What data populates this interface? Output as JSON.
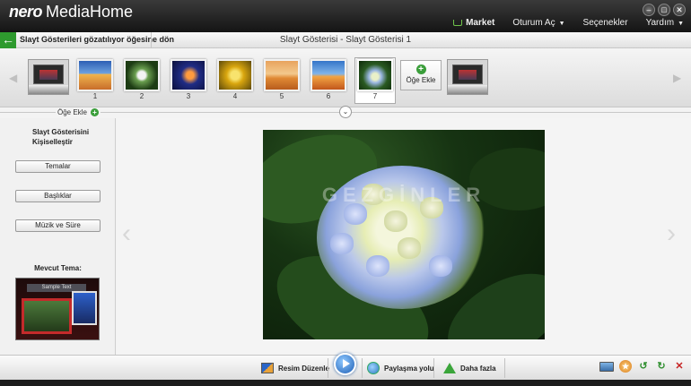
{
  "app": {
    "brand_nero": "nero",
    "brand_product": "MediaHome"
  },
  "window_controls": {
    "minimize": "–",
    "restore": "□",
    "close": "✕"
  },
  "topmenu": {
    "market": "Market",
    "login": "Oturum Aç",
    "options": "Seçenekler",
    "help": "Yardım"
  },
  "navbar": {
    "back_label": "Slayt Gösterileri gözatılıyor öğesine dön",
    "title": "Slayt Gösterisi - Slayt Gösterisi 1"
  },
  "strip": {
    "thumbnails": [
      {
        "number": "1",
        "scene": "desert-dune"
      },
      {
        "number": "2",
        "scene": "white-flower"
      },
      {
        "number": "3",
        "scene": "jellyfish"
      },
      {
        "number": "4",
        "scene": "yellow-flowers"
      },
      {
        "number": "5",
        "scene": "desert-camel"
      },
      {
        "number": "6",
        "scene": "desert-camel-sunset"
      },
      {
        "number": "7",
        "scene": "hydrangea"
      }
    ],
    "selected": "7",
    "add_item_label": "Öğe Ekle"
  },
  "stripfoot": {
    "add_item_label": "Öğe Ekle"
  },
  "leftpanel": {
    "title": "Slayt Gösterisini Kişiselleştir",
    "buttons": {
      "themes": "Temalar",
      "titles": "Başlıklar",
      "music": "Müzik ve Süre"
    },
    "current_theme_label": "Mevcut Tema:",
    "theme_preview_text": "Sample Text"
  },
  "preview": {
    "watermark": "GEZGİNLER"
  },
  "bottombar": {
    "edit_image": "Resim Düzenle",
    "share": "Paylaşma yolu",
    "more": "Daha fazla"
  },
  "colors": {
    "accent_green": "#2e9a2e",
    "title_bar": "#1c1c1c"
  }
}
